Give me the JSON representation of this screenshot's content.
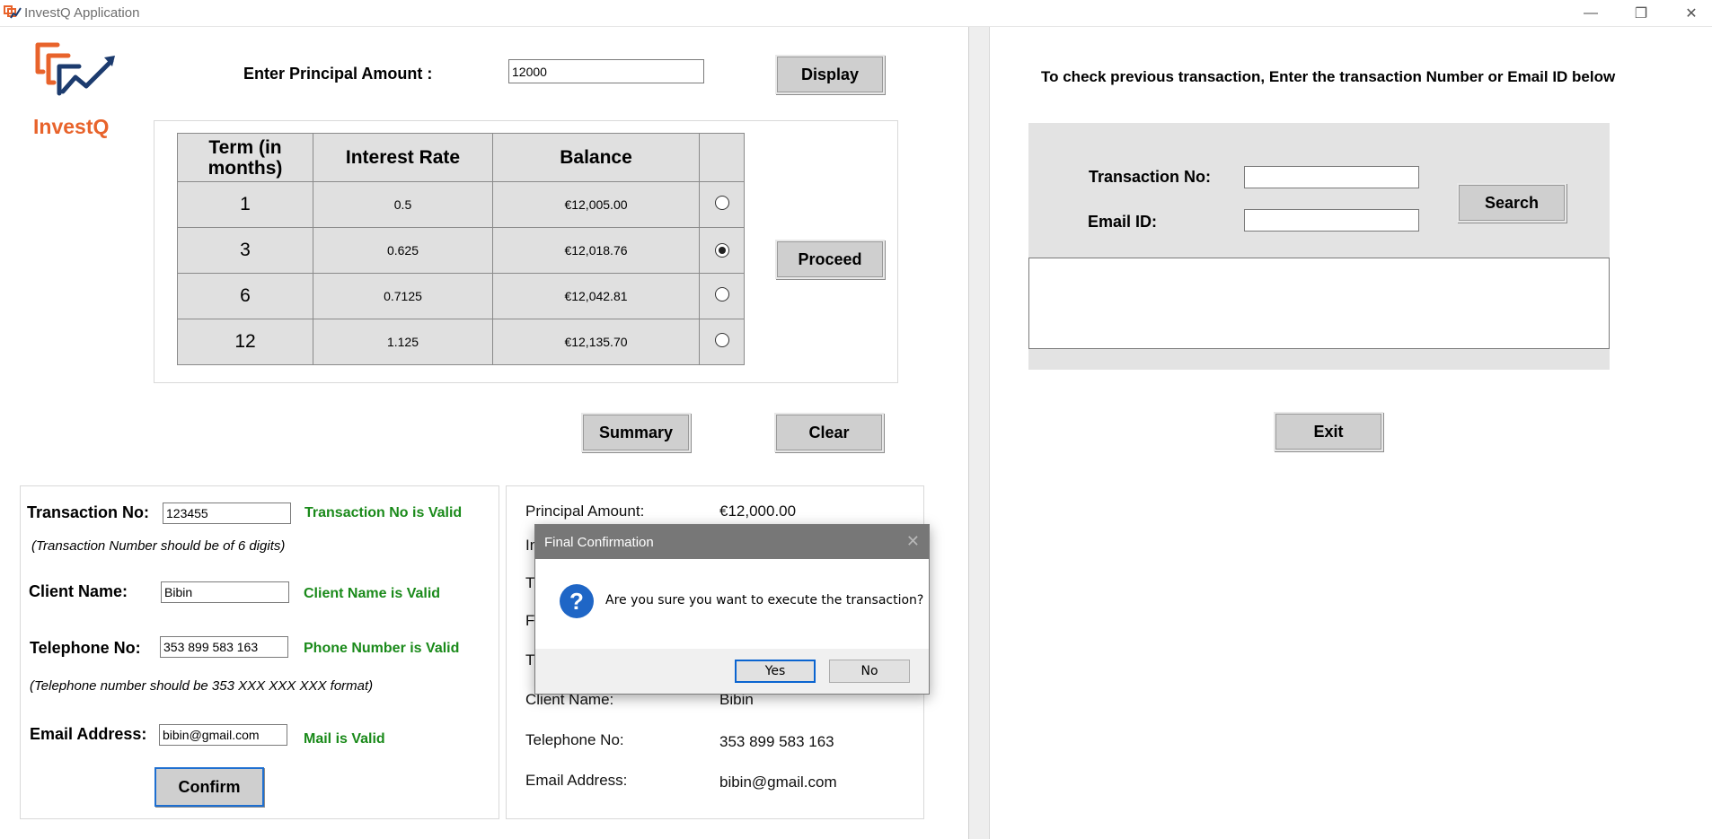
{
  "window": {
    "title": "InvestQ Application",
    "controls": {
      "minimize": "—",
      "maximize": "❐",
      "close": "✕"
    }
  },
  "logo": {
    "text": "InvestQ",
    "colors": {
      "orange": "#e8632b",
      "navy": "#1c3b6e"
    }
  },
  "principal": {
    "label": "Enter Principal Amount :",
    "value": "12000",
    "display_button": "Display"
  },
  "rate_table": {
    "headers": {
      "term": "Term (in months)",
      "rate": "Interest Rate",
      "balance": "Balance",
      "select": ""
    },
    "rows": [
      {
        "term": "1",
        "rate": "0.5",
        "balance": "€12,005.00",
        "selected": false
      },
      {
        "term": "3",
        "rate": "0.625",
        "balance": "€12,018.76",
        "selected": true
      },
      {
        "term": "6",
        "rate": "0.7125",
        "balance": "€12,042.81",
        "selected": false
      },
      {
        "term": "12",
        "rate": "1.125",
        "balance": "€12,135.70",
        "selected": false
      }
    ],
    "proceed_button": "Proceed"
  },
  "actions": {
    "summary_button": "Summary",
    "clear_button": "Clear"
  },
  "form": {
    "transaction_no": {
      "label": "Transaction No:",
      "value": "123455",
      "status": "Transaction No is Valid",
      "hint": "(Transaction Number should be of 6 digits)"
    },
    "client_name": {
      "label": "Client Name:",
      "value": "Bibin",
      "status": "Client Name is Valid"
    },
    "telephone": {
      "label": "Telephone No:",
      "value": "353 899 583 163",
      "status": "Phone Number is Valid",
      "hint": "(Telephone number should be 353 XXX XXX XXX format)"
    },
    "email": {
      "label": "Email Address:",
      "value": "bibin@gmail.com",
      "status": "Mail is Valid"
    },
    "confirm_button": "Confirm",
    "valid_color": "#1a8a1a"
  },
  "summary": {
    "principal_label": "Principal Amount:",
    "principal_value": "€12,000.00",
    "partial_labels": [
      "In",
      "T",
      "F",
      "T"
    ],
    "client_label": "Client Name:",
    "client_value": "Bibin",
    "telephone_label": "Telephone No:",
    "telephone_value": "353 899 583 163",
    "email_label": "Email Address:",
    "email_value": "bibin@gmail.com"
  },
  "dialog": {
    "title": "Final Confirmation",
    "message": "Are you sure you want to execute the transaction?",
    "icon": "question-icon",
    "icon_glyph": "?",
    "close_glyph": "✕",
    "yes": "Yes",
    "no": "No"
  },
  "lookup": {
    "instruction": "To check previous transaction, Enter the transaction Number or Email ID below",
    "transaction_label": "Transaction No:",
    "transaction_value": "",
    "email_label": "Email ID:",
    "email_value": "",
    "search_button": "Search",
    "result_text": ""
  },
  "exit_button": "Exit"
}
